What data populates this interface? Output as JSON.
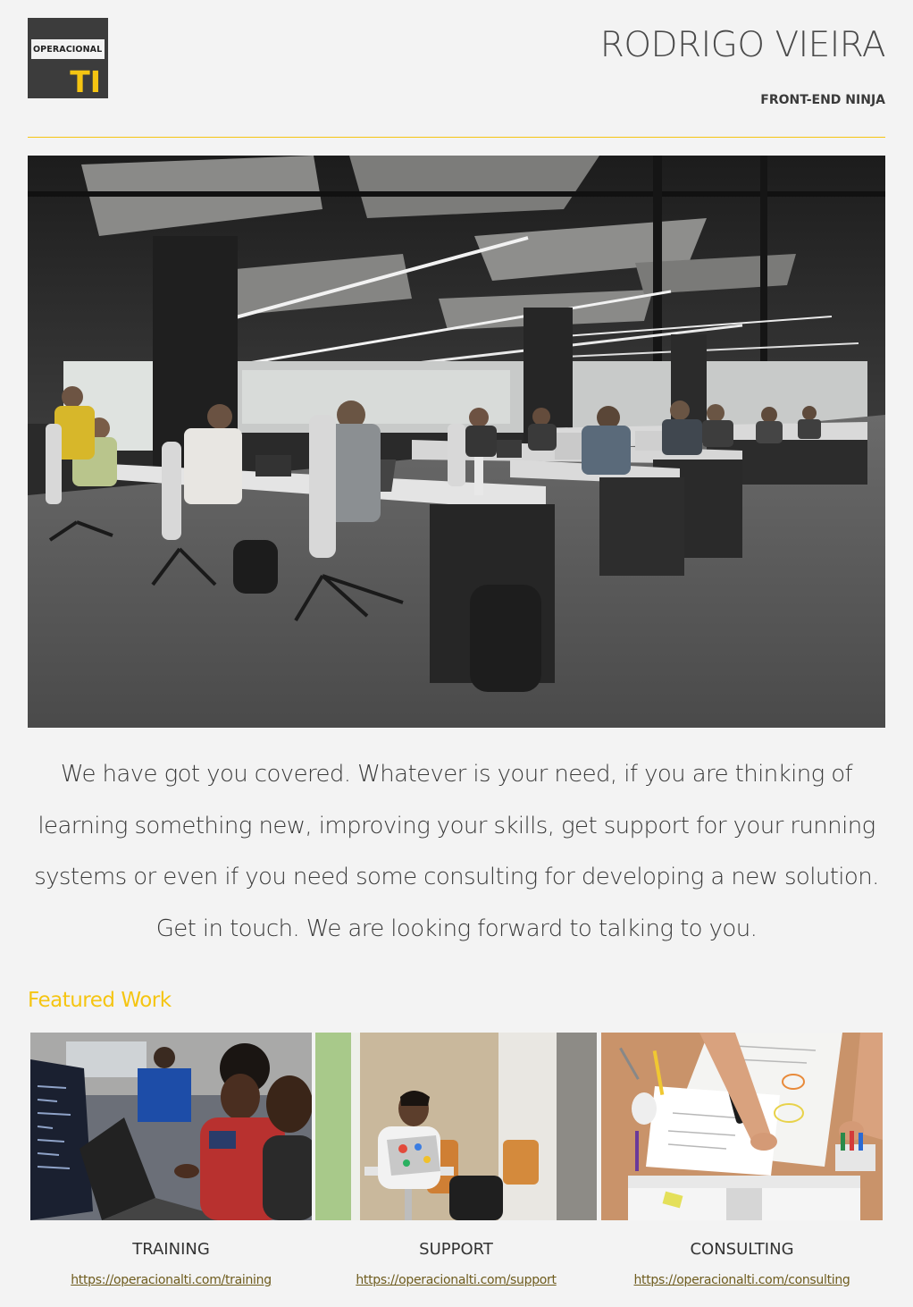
{
  "header": {
    "logo_text": "OPERACIONAL",
    "logo_mark": "TI",
    "name": "RODRIGO VIEIRA",
    "role": "FRONT-END NINJA"
  },
  "hero": {
    "image": "open-plan-office-photo"
  },
  "intro": {
    "text": "We have got you covered. Whatever is your need, if you are thinking of learning something new, improving your skills, get support for your running systems or even if you need some consulting for developing a new solution. Get in touch. We are looking forward to talking to you."
  },
  "featured": {
    "title": "Featured Work",
    "items": [
      {
        "label": "TRAINING",
        "link": "https://operacionalti.com/training",
        "image": "training-photo"
      },
      {
        "label": "SUPPORT",
        "link": "https://operacionalti.com/support",
        "image": "support-photo"
      },
      {
        "label": "CONSULTING",
        "link": "https://operacionalti.com/consulting",
        "image": "consulting-photo"
      }
    ]
  },
  "colors": {
    "accent": "#f5c512",
    "background": "#f3f3f3",
    "text": "#333333",
    "logo_bg": "#3c3c3c"
  }
}
